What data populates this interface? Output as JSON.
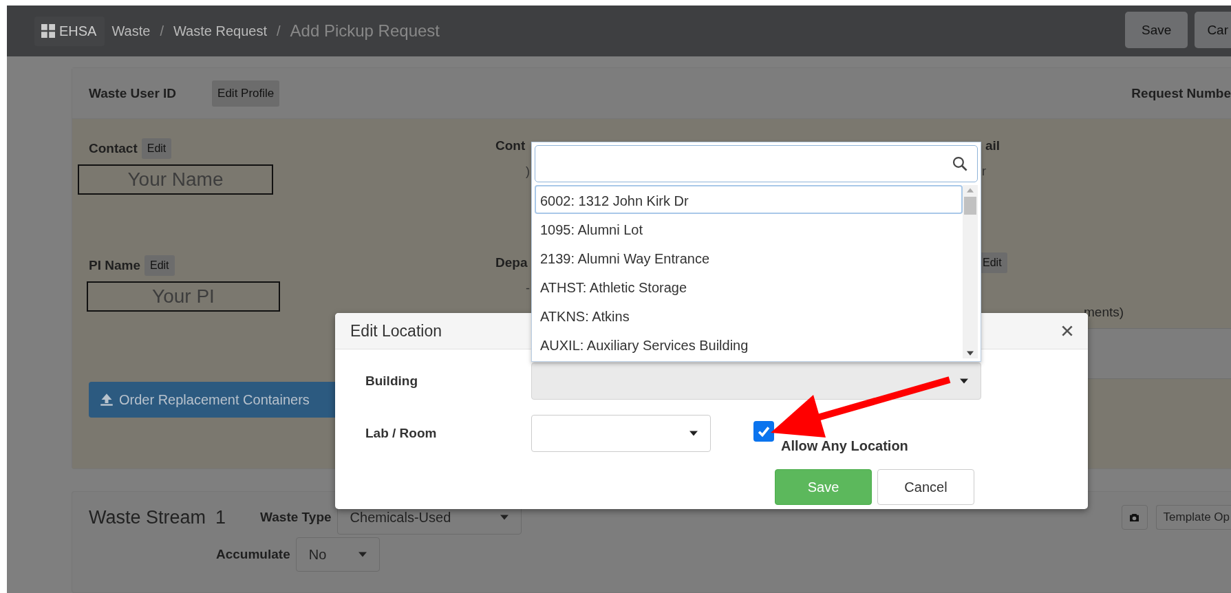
{
  "topbar": {
    "app": "EHSA",
    "breadcrumbs": [
      {
        "label": "Waste",
        "current": false
      },
      {
        "label": "Waste Request",
        "current": false
      },
      {
        "label": "Add Pickup Request",
        "current": true
      }
    ],
    "separator": "/",
    "buttons": [
      "Save",
      "Car"
    ]
  },
  "request_card": {
    "user_id_label": "Waste User ID",
    "edit_profile": "Edit Profile",
    "request_number_label": "Request Numbe",
    "contact": {
      "label": "Contact",
      "edit": "Edit",
      "value": "Your Name"
    },
    "contact_phone": {
      "label": "Cont",
      "value": ")"
    },
    "contact_email": {
      "label": "ail",
      "value": "r"
    },
    "pi": {
      "label": "PI Name",
      "edit": "Edit",
      "value": "Your PI"
    },
    "department": {
      "label": "Depa",
      "value": "-"
    },
    "column_3_edit": "Edit",
    "column_3_note": "ments)",
    "order_button": "Order Replacement Containers"
  },
  "waste_stream": {
    "title": "Waste Stream",
    "number": "1",
    "waste_type_label": "Waste Type",
    "waste_type": "Chemicals-Used",
    "accumulate_label": "Accumulate",
    "accumulate": "No",
    "template_button": "Template Op"
  },
  "modal": {
    "title": "Edit Location",
    "building_label": "Building",
    "lab_room_label": "Lab / Room",
    "allow_any_location": {
      "label": "Allow Any Location",
      "checked": true
    },
    "save": "Save",
    "cancel": "Cancel"
  },
  "building_dropdown": {
    "options": [
      {
        "label": "6002: 1312 John Kirk Dr",
        "selected": true
      },
      {
        "label": "1095: Alumni Lot",
        "selected": false
      },
      {
        "label": "2139: Alumni Way Entrance",
        "selected": false
      },
      {
        "label": "ATHST: Athletic Storage",
        "selected": false
      },
      {
        "label": "ATKNS: Atkins",
        "selected": false
      },
      {
        "label": "AUXIL: Auxiliary Services Building",
        "selected": false
      }
    ]
  }
}
